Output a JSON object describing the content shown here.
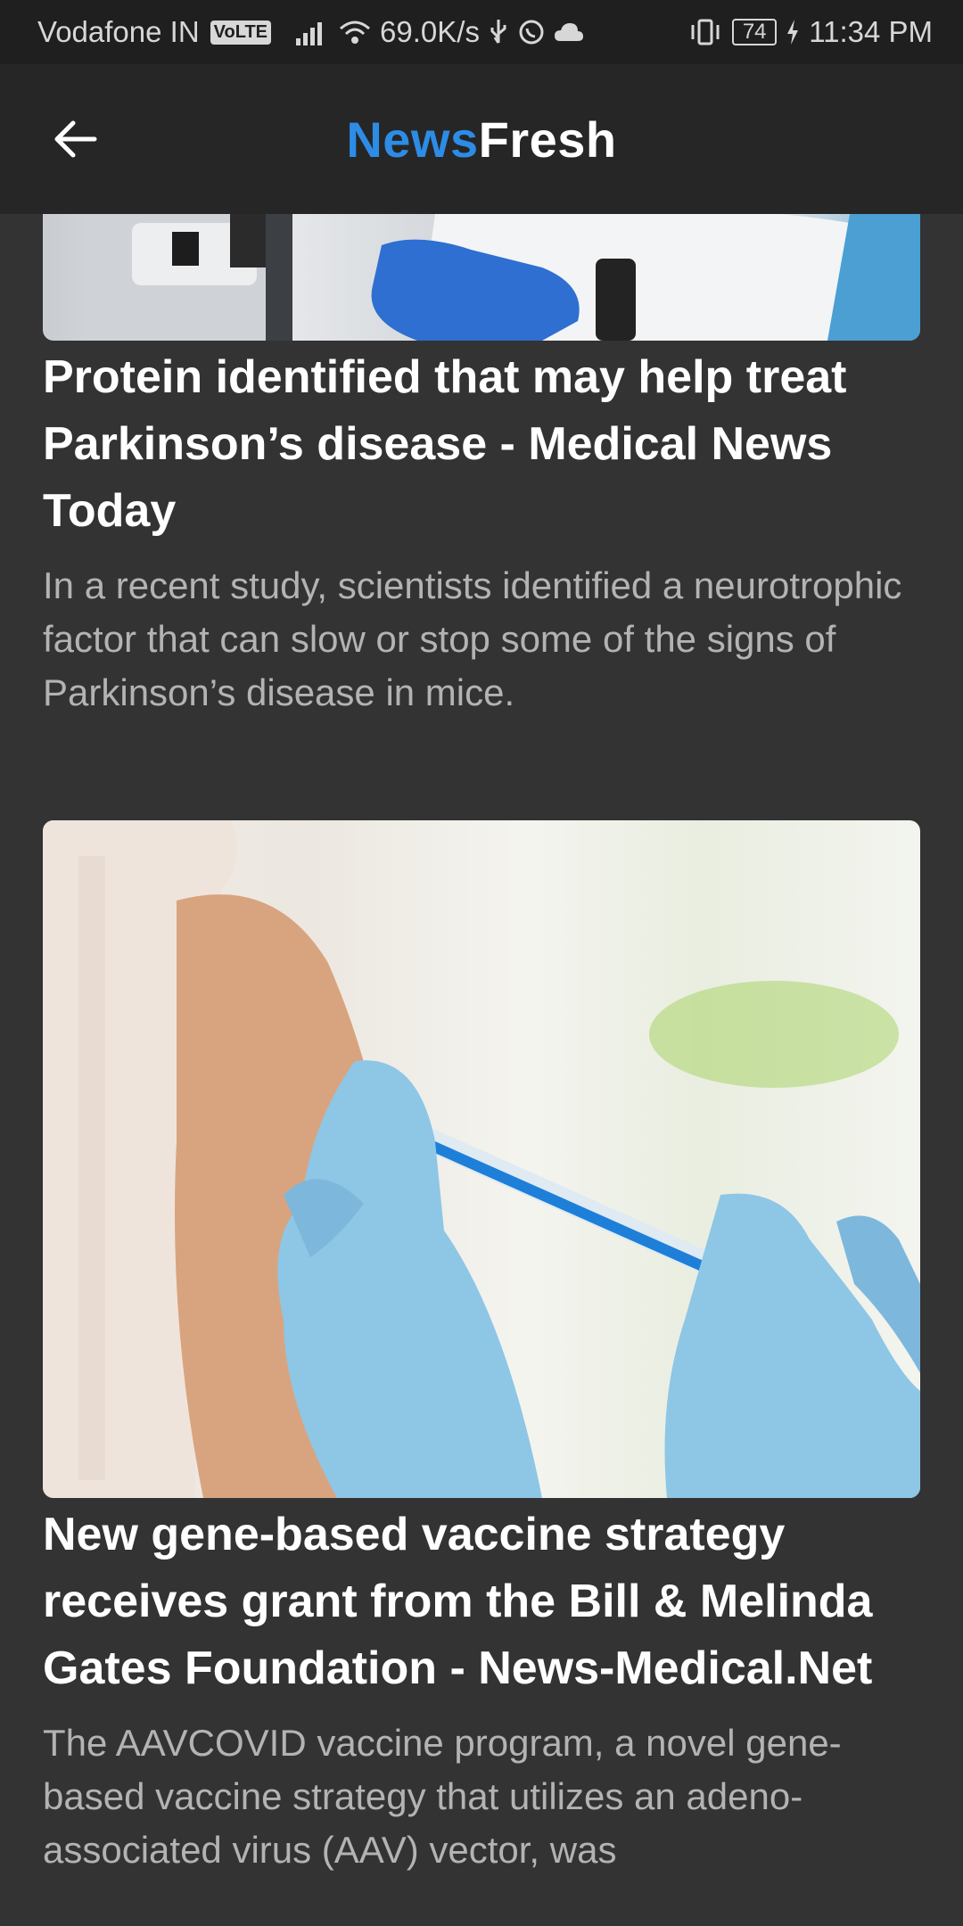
{
  "status_bar": {
    "carrier": "Vodafone IN",
    "volte": "VoLTE",
    "speed": "69.0K/s",
    "battery": "74",
    "time": "11:34 PM"
  },
  "app_bar": {
    "brand_part1": "News",
    "brand_part2": "Fresh",
    "brand_color": "#2d8ce6"
  },
  "articles": [
    {
      "title": "Protein identified that may help treat Parkinson’s disease - Medical News Today",
      "description": "In a recent study, scientists identified a neurotrophic factor that can slow or stop some of the signs of Parkinson’s disease in mice."
    },
    {
      "title": "New gene-based vaccine strategy receives grant from the Bill & Melinda Gates Foundation - News-Medical.Net",
      "description": "The AAVCOVID vaccine program, a novel gene-based vaccine strategy that utilizes an adeno-associated virus (AAV) vector, was"
    }
  ]
}
